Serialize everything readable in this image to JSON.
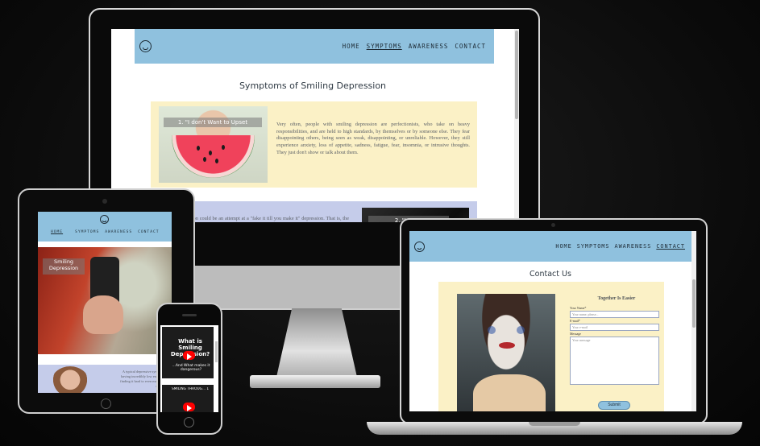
{
  "site": {
    "nav": {
      "home": "HOME",
      "symptoms": "SYMPTOMS",
      "awareness": "AWARENESS",
      "contact": "CONTACT"
    },
    "colors": {
      "navbar": "#8fc1de",
      "card_yellow": "#fbf1c6",
      "card_blue": "#c5ccea",
      "submit": "#8fc1de"
    }
  },
  "imac": {
    "heading": "Symptoms of Smiling Depression",
    "card1": {
      "caption": "1. \"I don't Want to Upset",
      "text": "Very often, people with smiling depression are perfectionists, who take on heavy responsibilities, and are held to high standards, by themselves or by someone else. They fear disappointing others, being seen as weak, disappointing, or unreliable. However, they still experience anxiety, loss of appetite, sadness, fatigue, fear, insomnia, or intrusive thoughts. They just don't show or talk about them."
    },
    "card2": {
      "caption": "2. \"I Want",
      "text": "ssion could be an attempt at a \"fake it till you make it\" depression. That is, the person may believe that by thing, and going about their day-to-day life as if re OK, they can eventually force themselves to feel OK. just to please the people around you or make them more can actually be quite isolating, and that feeling of make depression worse, not better."
    }
  },
  "tablet": {
    "hero_caption": "Smiling Depression",
    "snippet": "A typical depressive symptom is having incredibly low energy and finding it hard to even make it out of bed in"
  },
  "phone": {
    "video1_title": "What is Smiling Depression?",
    "video1_subtitle": "...And What makes it dangerous?",
    "video2_title": "SMILING THROUG... 1"
  },
  "laptop": {
    "heading": "Contact Us",
    "form": {
      "title": "Together Is Easier",
      "name_label": "Your Name*",
      "name_placeholder": "Your name, please...",
      "email_label": "E-mail*",
      "email_placeholder": "Your e-mail",
      "message_label": "Message",
      "message_placeholder": "Your message",
      "submit": "Submit"
    }
  }
}
